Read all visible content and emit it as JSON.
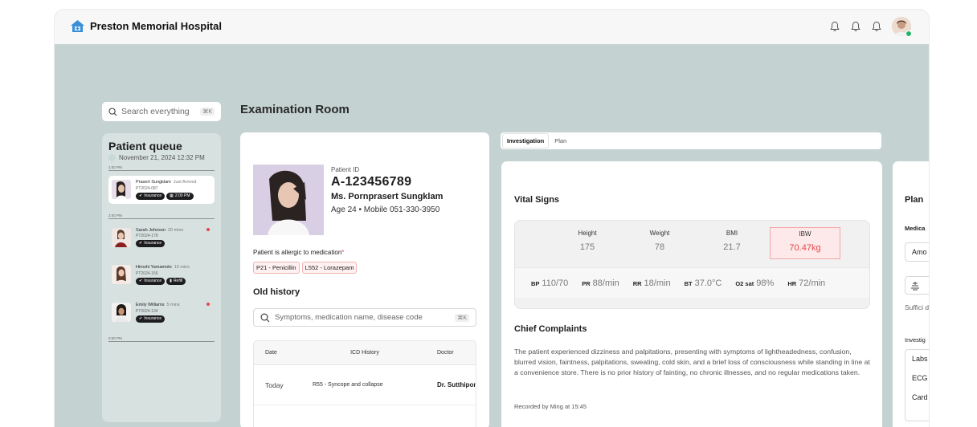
{
  "app": {
    "title": "Preston Memorial Hospital"
  },
  "search": {
    "placeholder": "Search everything",
    "shortcut": "⌘K"
  },
  "page": {
    "title": "Examination Room"
  },
  "queue": {
    "title": "Patient queue",
    "date": "November 21, 2024 12:32 PM",
    "slots": [
      "1:00 PM",
      "2:00 PM",
      "3:00 PM"
    ],
    "patients": [
      {
        "name": "Prasert Sungklam",
        "since": "Just Arrived",
        "id": "PT2024-087",
        "tags": [
          "Insurance",
          "2:00 PM"
        ]
      },
      {
        "name": "Sarah Johnson",
        "since": "20 mins",
        "id": "PT2024-178",
        "tags": [
          "Insurance"
        ]
      },
      {
        "name": "Hiroshi Yamamoto",
        "since": "10 mins",
        "id": "PT2024-156",
        "tags": [
          "Insurance",
          "Refill"
        ]
      },
      {
        "name": "Emily Williams",
        "since": "5 mins",
        "id": "PT2024-134",
        "tags": [
          "Insurance"
        ]
      }
    ]
  },
  "patient": {
    "id_label": "Patient ID",
    "id": "A-123456789",
    "name": "Ms. Pornprasert Sungklam",
    "meta": "Age 24 • Mobile 051-330-3950",
    "allergy_label": "Patient is allergic to medication",
    "allergy_required": "*",
    "allergies": [
      "P21 - Penicillin",
      "L552 - Lorazepam"
    ]
  },
  "history": {
    "title": "Old history",
    "search_placeholder": "Symptoms, medication name, disease code",
    "shortcut": "⌘K",
    "columns": [
      "Date",
      "ICD History",
      "Doctor"
    ],
    "rows": [
      {
        "date": "Today",
        "icd": "R55 - Syncope and collapse",
        "doctor": "Dr. Sutthipon"
      }
    ]
  },
  "tabs": [
    {
      "label": "Investigation",
      "active": true
    },
    {
      "label": "Plan",
      "active": false
    }
  ],
  "vitals": {
    "title": "Vital Signs",
    "top": [
      {
        "label": "Height",
        "value": "175"
      },
      {
        "label": "Weight",
        "value": "78"
      },
      {
        "label": "BMI",
        "value": "21.7"
      },
      {
        "label": "IBW",
        "value": "70.47kg",
        "highlight": true
      }
    ],
    "bottom": [
      {
        "label": "BP",
        "value": "110/70"
      },
      {
        "label": "PR",
        "value": "88/min"
      },
      {
        "label": "RR",
        "value": "18/min"
      },
      {
        "label": "BT",
        "value": "37.0°C"
      },
      {
        "label": "O2 sat",
        "value": "98%"
      },
      {
        "label": "HR",
        "value": "72/min"
      }
    ]
  },
  "complaints": {
    "title": "Chief Complaints",
    "text": "The patient experienced dizziness and palpitations, presenting with symptoms of lightheadedness, confusion, blurred vision, faintness, palpitations, sweating, cold skin, and a brief loss of consciousness while standing in line at a convenience store. There is no prior history of fainting, no chronic illnesses, and no regular medications taken.",
    "recorded": "Recorded by Ming at 15:45"
  },
  "plan": {
    "title": "Plan",
    "medication_label": "Medica",
    "medication_value": "Amo",
    "sufficient": "Suffici days",
    "investigation_label": "Investig",
    "items": [
      "Labs",
      "ECG",
      "Card"
    ]
  },
  "colors": {
    "background": "#c4d3d1",
    "alert": "#e5484d",
    "online": "#22b46a"
  },
  "icons": [
    "home-icon",
    "bell-icon",
    "search-icon",
    "check-icon",
    "calendar-icon",
    "refill-icon",
    "pill-icon"
  ]
}
